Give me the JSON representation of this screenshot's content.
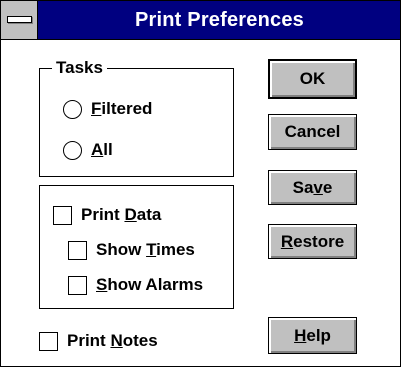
{
  "window": {
    "title": "Print Preferences"
  },
  "tasks_group": {
    "label": "Tasks",
    "options": [
      {
        "pre": "",
        "u": "F",
        "post": "iltered"
      },
      {
        "pre": "",
        "u": "A",
        "post": "ll"
      }
    ]
  },
  "print_group": {
    "print_data": {
      "pre": "Print ",
      "u": "D",
      "post": "ata"
    },
    "show_times": {
      "pre": "Show ",
      "u": "T",
      "post": "imes"
    },
    "show_alarms": {
      "pre": "",
      "u": "S",
      "post": "how Alarms"
    }
  },
  "print_notes": {
    "pre": "Print ",
    "u": "N",
    "post": "otes"
  },
  "buttons": {
    "ok": {
      "pre": "OK",
      "u": "",
      "post": ""
    },
    "cancel": {
      "pre": "Cancel",
      "u": "",
      "post": ""
    },
    "save": {
      "pre": "Sa",
      "u": "v",
      "post": "e"
    },
    "restore": {
      "pre": "",
      "u": "R",
      "post": "estore"
    },
    "help": {
      "pre": "",
      "u": "H",
      "post": "elp"
    }
  },
  "colors": {
    "titlebar": "#000080",
    "button_face": "#c0c0c0"
  }
}
